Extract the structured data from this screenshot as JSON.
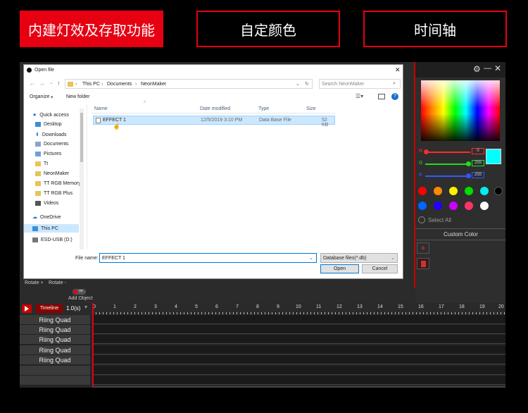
{
  "tabs": [
    {
      "label": "内建灯效及存取功能"
    },
    {
      "label": "自定颜色"
    },
    {
      "label": "时间轴"
    }
  ],
  "colors": {
    "accent": "#e60012",
    "selected_cyan": "#00ffff"
  },
  "color_panel": {
    "icons": [
      "gear-icon",
      "close-icon"
    ],
    "sliders": [
      {
        "name": "R",
        "value": "0",
        "color": "#ff2a2a"
      },
      {
        "name": "G",
        "value": "255",
        "color": "#22dd22"
      },
      {
        "name": "B",
        "value": "255",
        "color": "#3355ff"
      }
    ],
    "swatches_row1": [
      "#ff0000",
      "#ff8800",
      "#ffee00",
      "#00dd00",
      "#00eeee",
      "#000000"
    ],
    "swatches_row2": [
      "#0066ff",
      "#2200ff",
      "#cc00ff",
      "#ff3366",
      "#ffffff"
    ],
    "select_all": "Select All",
    "custom_color": "Custom Color"
  },
  "dialog": {
    "title": "Open file",
    "breadcrumb": [
      "This PC",
      "Documents",
      "NeonMaker"
    ],
    "search_placeholder": "Search NeonMaker",
    "organize": "Organize",
    "new_folder": "New folder",
    "columns": [
      "Name",
      "Date modified",
      "Type",
      "Size"
    ],
    "files": [
      {
        "name": "EFFECT 1",
        "date": "12/5/2019 3:10 PM",
        "type": "Data Base File",
        "size": "52 KB"
      }
    ],
    "nav": [
      "Quick access",
      "Desktop",
      "Downloads",
      "Documents",
      "Pictures",
      "Tt",
      "NeonMaker",
      "TT RGB Memory",
      "TT RGB Plus",
      "Videos",
      "OneDrive",
      "This PC",
      "ESD-USB (D:)"
    ],
    "file_name_label": "File name:",
    "file_name_value": "EFFECT 1",
    "file_type": "Database files(*.db)",
    "open": "Open",
    "cancel": "Cancel"
  },
  "left_controls": {
    "rotate_plus": "Rotate +",
    "rotate_minus": "Rotate -",
    "toggle": "on",
    "add_object": "Add Object"
  },
  "timeline": {
    "label": "Timeline",
    "speed": "1.0(s)",
    "ticks": [
      "0",
      "1",
      "2",
      "3",
      "4",
      "5",
      "6",
      "7",
      "8",
      "9",
      "10",
      "11",
      "12",
      "13",
      "14",
      "15",
      "16",
      "17",
      "18",
      "19",
      "20"
    ],
    "tracks": [
      "Riing Quad",
      "Riing Quad",
      "Riing Quad",
      "Riing Quad",
      "Riing Quad"
    ]
  }
}
